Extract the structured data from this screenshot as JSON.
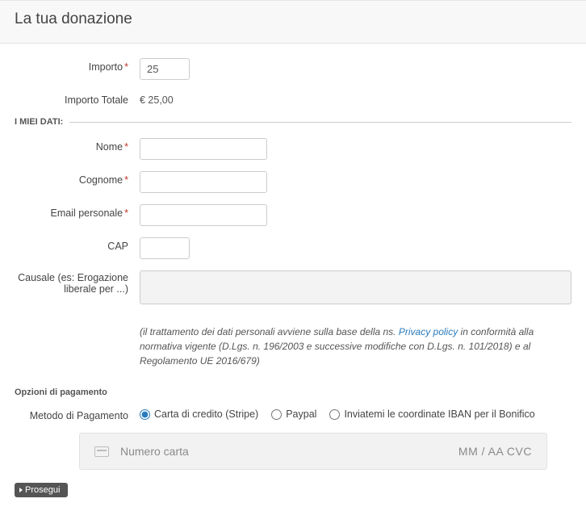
{
  "header": {
    "title": "La tua donazione"
  },
  "amount": {
    "label": "Importo",
    "value": "25",
    "total_label": "Importo Totale",
    "total_value": "€ 25,00"
  },
  "personal": {
    "legend": "I MIEI DATI:",
    "name_label": "Nome",
    "surname_label": "Cognome",
    "email_label": "Email personale",
    "cap_label": "CAP",
    "cause_label": "Causale (es: Erogazione liberale per ...)"
  },
  "privacy": {
    "pre": "(il trattamento dei dati personali avviene sulla base della ns. ",
    "link": "Privacy policy",
    "post": " in conformità alla normativa vigente (D.Lgs. n. 196/2003 e successive modifiche con D.Lgs. n. 101/2018) e al Regolamento UE 2016/679)"
  },
  "payment": {
    "heading": "Opzioni di pagamento",
    "method_label": "Metodo di Pagamento",
    "options": {
      "card": "Carta di credito (Stripe)",
      "paypal": "Paypal",
      "iban": "Inviatemi le coordinate IBAN per il Bonifico"
    },
    "card_placeholder": "Numero carta",
    "card_right": "MM / AA CVC"
  },
  "actions": {
    "proceed": "Prosegui"
  }
}
